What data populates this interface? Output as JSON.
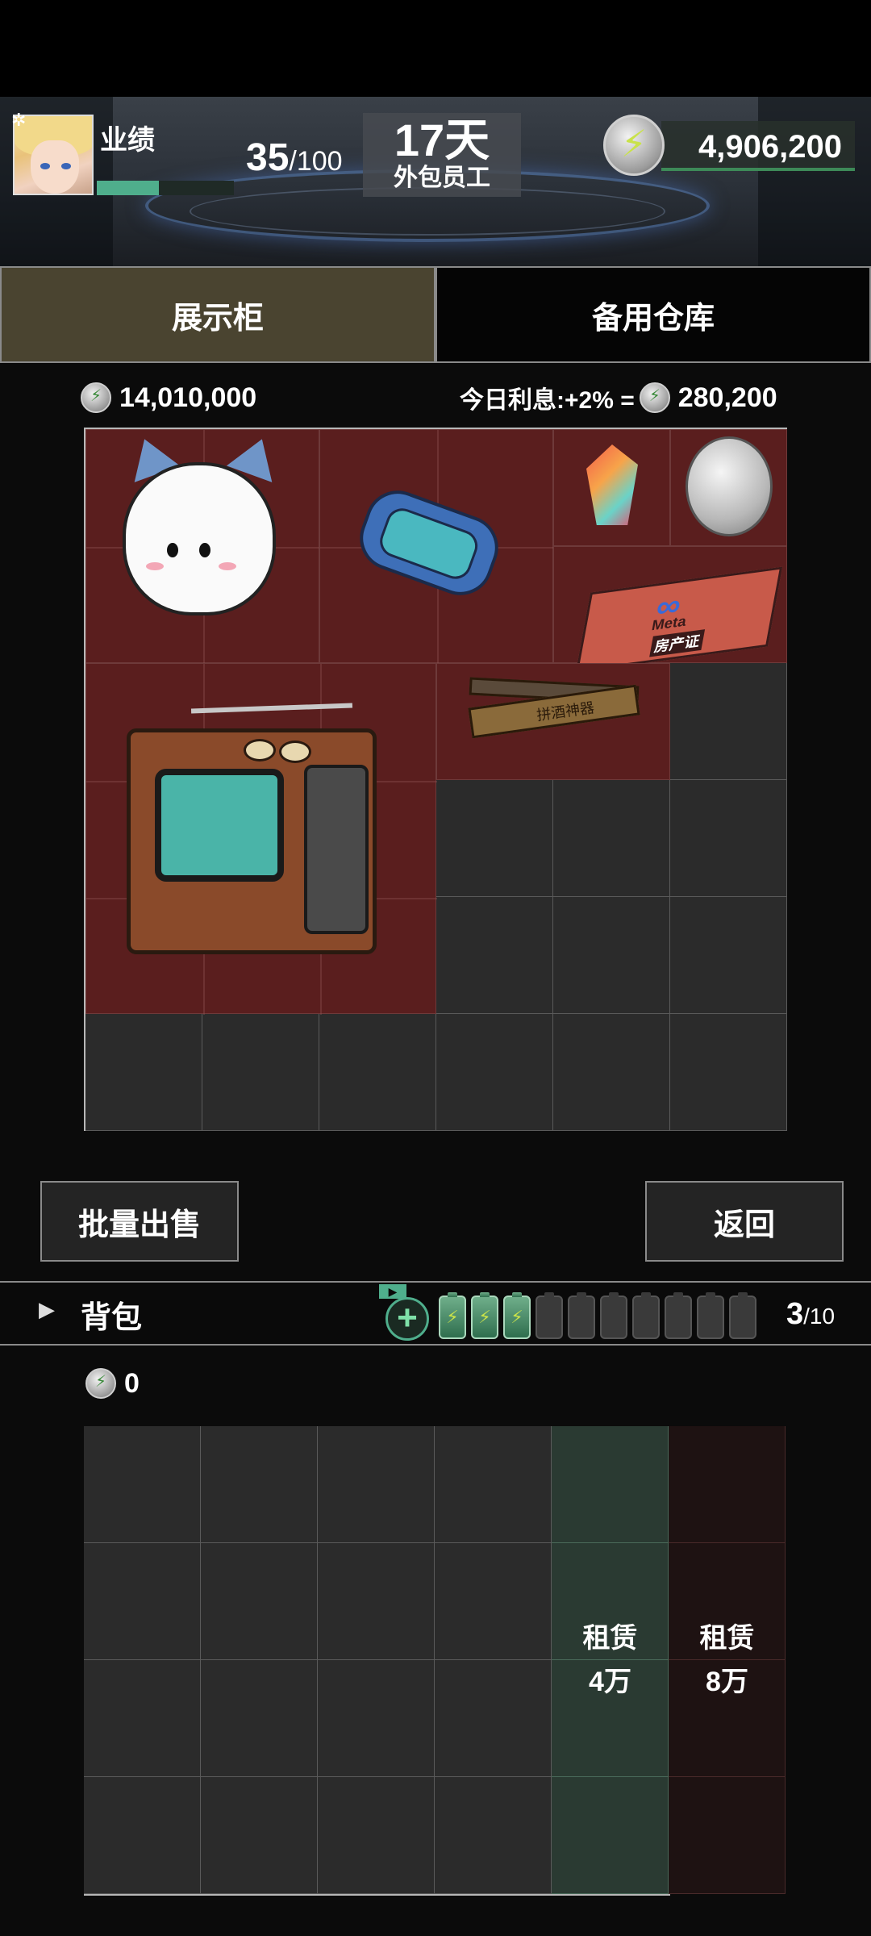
{
  "header": {
    "performance_label": "业绩",
    "performance_current": "35",
    "performance_max": "/100",
    "performance_progress": 0.45,
    "days": "17天",
    "role": "外包员工",
    "money": "4,906,200"
  },
  "tabs": [
    {
      "label": "展示柜",
      "active": true
    },
    {
      "label": "备用仓库",
      "active": false
    }
  ],
  "display": {
    "total_value": "14,010,000",
    "interest_label": "今日利息:+2% =",
    "interest_value": "280,200"
  },
  "items": {
    "meta_card_logo": "Meta",
    "meta_card_text": "房产证",
    "stick_text": "拼酒神器"
  },
  "buttons": {
    "bulk_sell": "批量出售",
    "back": "返回"
  },
  "backpack": {
    "label": "背包",
    "count": "3",
    "max": "/10",
    "value": "0",
    "rent_a_label": "租赁",
    "rent_a_price": "4万",
    "rent_b_label": "租赁",
    "rent_b_price": "8万"
  },
  "colors": {
    "accent_green": "#4fae8c",
    "active_tab": "#4a4430",
    "item_bg": "#5a1e1e"
  },
  "icons": [
    "settings-icon",
    "lightning-coin-icon",
    "add-icon",
    "battery-icon",
    "expand-arrow-icon"
  ]
}
